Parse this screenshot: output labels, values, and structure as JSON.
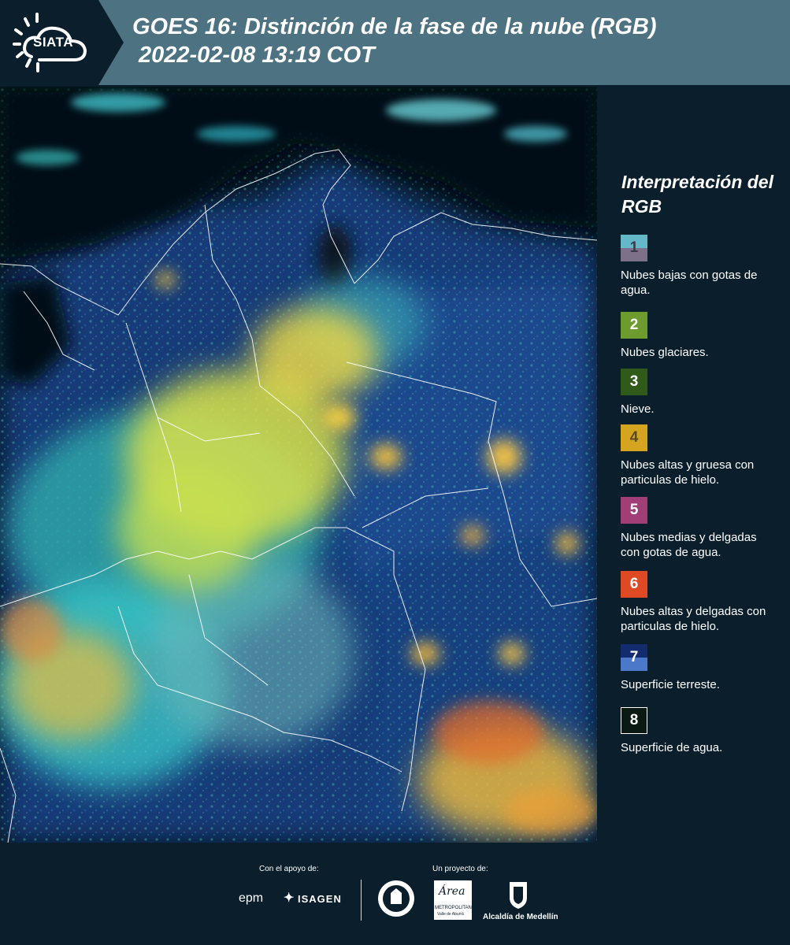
{
  "header": {
    "logo_text": "SIATA",
    "title_line1": "GOES 16: Distinción de la fase de la nube (RGB)",
    "title_line2": "2022-02-08 13:19 COT"
  },
  "legend": {
    "title": "Interpretación del RGB",
    "items": [
      {
        "number": "1",
        "label": "Nubes bajas con gotas de agua.",
        "color_top": "#63b9c8",
        "color_bottom": "#7d7189"
      },
      {
        "number": "2",
        "label": "Nubes glaciares.",
        "color": "#6e9b2e"
      },
      {
        "number": "3",
        "label": "Nieve.",
        "color": "#2f5a1a"
      },
      {
        "number": "4",
        "label": "Nubes altas y gruesa con particulas de hielo.",
        "color": "#d6a520"
      },
      {
        "number": "5",
        "label": "Nubes medias y delgadas con gotas de agua.",
        "color": "#a13e77"
      },
      {
        "number": "6",
        "label": "Nubes altas y delgadas con particulas de hielo.",
        "color": "#df4a25"
      },
      {
        "number": "7",
        "label": "Superficie terreste.",
        "color_top": "#142c6e",
        "color_bottom": "#4b78c8"
      },
      {
        "number": "8",
        "label": "Superficie de agua.",
        "color": "#0a1a12"
      }
    ]
  },
  "footer": {
    "support_label": "Con el apoyo de:",
    "project_label": "Un proyecto de:",
    "sponsor1": "epm",
    "sponsor2": "ISAGEN",
    "partner1_line1": "METROPOLITANA",
    "partner1_line2": "Valle de Aburrá",
    "partner1_script": "Área",
    "partner2": "Alcaldía de Medellín"
  }
}
